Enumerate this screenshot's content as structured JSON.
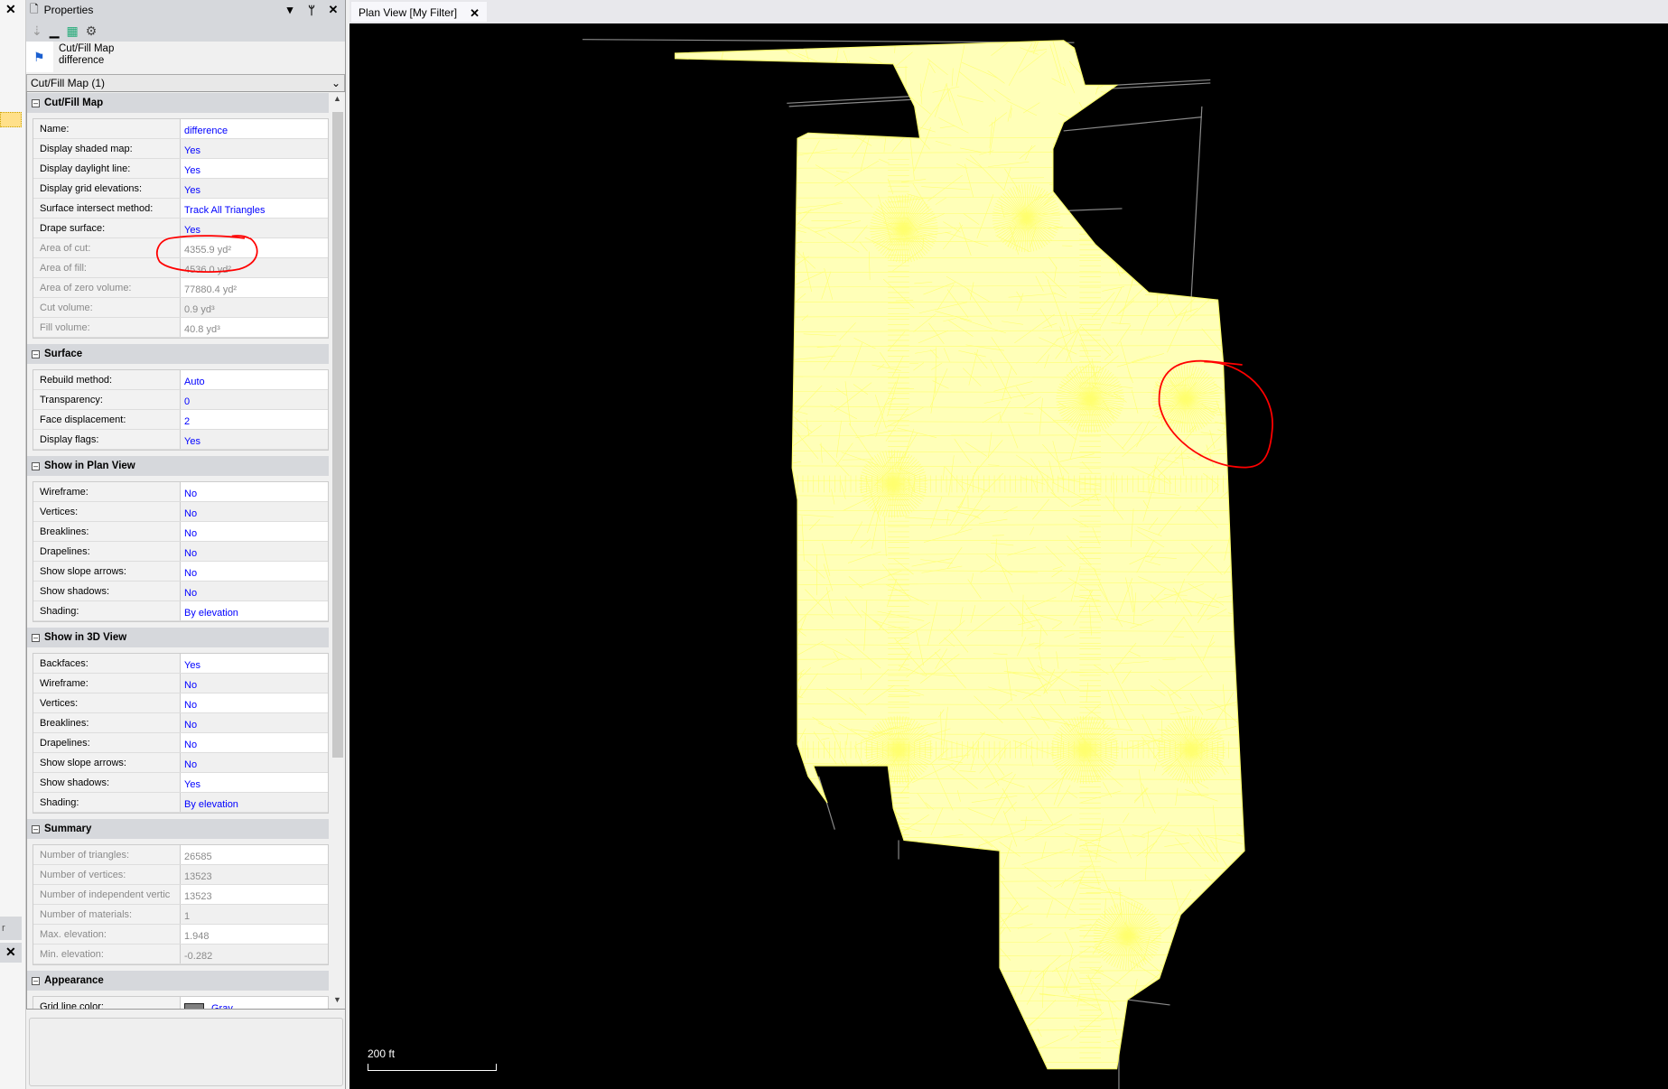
{
  "properties_panel": {
    "title": "Properties",
    "object_type": "Cut/Fill Map",
    "object_name": "difference",
    "selector": "Cut/Fill Map (1)",
    "sections": [
      {
        "title": "Cut/Fill Map",
        "rows": [
          {
            "label": "Name:",
            "value": "difference",
            "readonly": false
          },
          {
            "label": "Display shaded map:",
            "value": "Yes",
            "readonly": false
          },
          {
            "label": "Display daylight line:",
            "value": "Yes",
            "readonly": false
          },
          {
            "label": "Display grid elevations:",
            "value": "Yes",
            "readonly": false
          },
          {
            "label": "Surface intersect method:",
            "value": "Track All Triangles",
            "readonly": false
          },
          {
            "label": "Drape surface:",
            "value": "Yes",
            "readonly": false
          },
          {
            "label": "Area of cut:",
            "value": "4355.9 yd²",
            "readonly": true
          },
          {
            "label": "Area of fill:",
            "value": "4536.0 yd²",
            "readonly": true
          },
          {
            "label": "Area of zero volume:",
            "value": "77880.4 yd²",
            "readonly": true
          },
          {
            "label": "Cut volume:",
            "value": "0.9 yd³",
            "readonly": true
          },
          {
            "label": "Fill volume:",
            "value": "40.8 yd³",
            "readonly": true
          }
        ]
      },
      {
        "title": "Surface",
        "rows": [
          {
            "label": "Rebuild method:",
            "value": "Auto",
            "readonly": false
          },
          {
            "label": "Transparency:",
            "value": "0",
            "readonly": false
          },
          {
            "label": "Face displacement:",
            "value": "2",
            "readonly": false
          },
          {
            "label": "Display flags:",
            "value": "Yes",
            "readonly": false
          }
        ]
      },
      {
        "title": "Show in Plan View",
        "rows": [
          {
            "label": "Wireframe:",
            "value": "No",
            "readonly": false
          },
          {
            "label": "Vertices:",
            "value": "No",
            "readonly": false
          },
          {
            "label": "Breaklines:",
            "value": "No",
            "readonly": false
          },
          {
            "label": "Drapelines:",
            "value": "No",
            "readonly": false
          },
          {
            "label": "Show slope arrows:",
            "value": "No",
            "readonly": false
          },
          {
            "label": "Show shadows:",
            "value": "No",
            "readonly": false
          },
          {
            "label": "Shading:",
            "value": "By elevation",
            "readonly": false
          }
        ]
      },
      {
        "title": "Show in 3D View",
        "rows": [
          {
            "label": "Backfaces:",
            "value": "Yes",
            "readonly": false
          },
          {
            "label": "Wireframe:",
            "value": "No",
            "readonly": false
          },
          {
            "label": "Vertices:",
            "value": "No",
            "readonly": false
          },
          {
            "label": "Breaklines:",
            "value": "No",
            "readonly": false
          },
          {
            "label": "Drapelines:",
            "value": "No",
            "readonly": false
          },
          {
            "label": "Show slope arrows:",
            "value": "No",
            "readonly": false
          },
          {
            "label": "Show shadows:",
            "value": "Yes",
            "readonly": false
          },
          {
            "label": "Shading:",
            "value": "By elevation",
            "readonly": false
          }
        ]
      },
      {
        "title": "Summary",
        "rows": [
          {
            "label": "Number of triangles:",
            "value": "26585",
            "readonly": true
          },
          {
            "label": "Number of vertices:",
            "value": "13523",
            "readonly": true
          },
          {
            "label": "Number of independent vertic",
            "value": "13523",
            "readonly": true
          },
          {
            "label": "Number of materials:",
            "value": "1",
            "readonly": true
          },
          {
            "label": "Max. elevation:",
            "value": "1.948",
            "readonly": true
          },
          {
            "label": "Min. elevation:",
            "value": "-0.282",
            "readonly": true
          }
        ]
      },
      {
        "title": "Appearance",
        "rows": [
          {
            "label": "Grid line color:",
            "value": "Gray",
            "readonly": false,
            "swatch": "#808080"
          },
          {
            "label": "",
            "value": "",
            "readonly": false,
            "swatch": "#222222"
          }
        ]
      }
    ]
  },
  "plan_view": {
    "tab_label": "Plan View [My Filter]",
    "scale_label": "200 ft",
    "mesh_color": "#ffff70",
    "annotation_color": "#ff0000"
  },
  "left_strip": {
    "tab_fragment": "r"
  }
}
